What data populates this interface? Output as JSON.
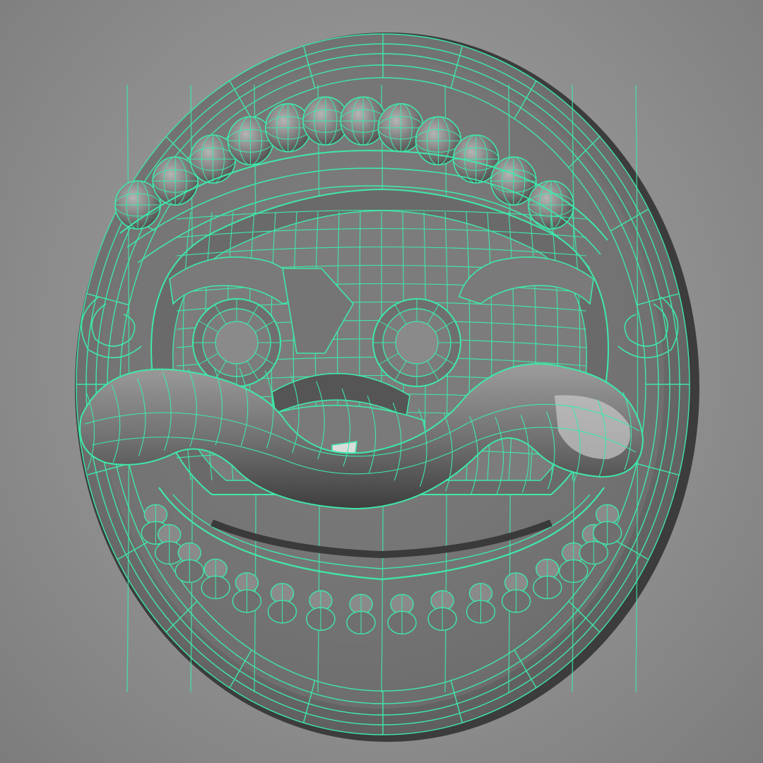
{
  "scene": {
    "subject": "wireframe-relief-medallion",
    "colors": {
      "background": "#8f8f8f",
      "background_light": "#a3a3a3",
      "background_dark": "#7c7c7c",
      "surface": "#727272",
      "surface_dark": "#4a4a4a",
      "surface_light": "#9a9a9a",
      "highlight": "#d8d8d8",
      "wireframe": "#3fe8a8",
      "wireframe_dim": "#2fc58c"
    },
    "icons": {
      "medallion": "wireframe-mask-icon"
    }
  }
}
